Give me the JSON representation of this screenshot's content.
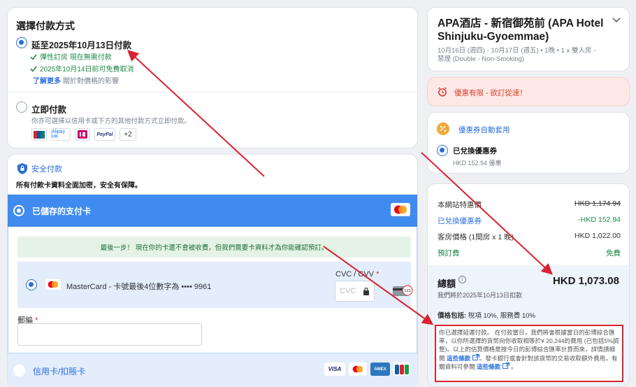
{
  "payment_method": {
    "title": "選擇付款方式",
    "pay_later": {
      "label": "延至2025年10月13日付款",
      "bullet_1": "彈性訂房 現在無需付款",
      "bullet_2": "2025年10月14日前可免費取消",
      "learn_more": "了解更多",
      "learn_more_sub": "關於對價格的影響"
    },
    "pay_now": {
      "label": "立即付款",
      "sub": "你亦可選擇以信用卡或下方的其他付款方式立即付款。",
      "logos": [
        "UnionPay",
        "Alipay HK",
        "iDEAL",
        "PayPal"
      ],
      "more": "+2"
    }
  },
  "secure": {
    "title": "安全付款",
    "subtitle": "所有付款卡資料全面加密，安全有保障。",
    "saved_card_label": "已儲存的支付卡",
    "notice": "最後一步！ 現在你的卡還不會被收費，但我們需要卡資料才為你能確認預訂。",
    "card_number": "MasterCard - 卡號最後4位數字為 •••• 9961",
    "cvc_label": "CVC / CVV",
    "required_mark": "*",
    "cvc_placeholder": "CVC",
    "cvc_card_text": "123",
    "postal_label": "郵編",
    "credit_card_label": "信用卡/扣賬卡",
    "brands": [
      "VISA",
      "MC",
      "AMEX",
      "JCB"
    ]
  },
  "hotel": {
    "name": "APA酒店 - 新宿御苑前 (APA Hotel Shinjuku-Gyoemmae)",
    "details": "10月16日 (週四) - 10月17日 (週五) • 1晚 • 1 x 雙人房 - 禁煙 (Double - Non-Smoking)"
  },
  "urgency": {
    "text": "優惠有限 - 欲訂從速！"
  },
  "coupon": {
    "heading": "優惠券自動套用",
    "label": "已兌換優惠券",
    "value": "HKD 152.94 優惠"
  },
  "price": {
    "rows": [
      {
        "label": "本網站特惠價",
        "value": "HKD 1,174.94"
      },
      {
        "label": "已兌換優惠券",
        "value": "-HKD 152.94"
      },
      {
        "label": "客房價格 (1間房 x 1 晚)",
        "value": "HKD 1,022.00"
      },
      {
        "label": "預訂費",
        "value": "免費"
      }
    ],
    "total_label": "總額",
    "total_info": "i",
    "total_value": "HKD 1,073.08",
    "total_sub": "我們將於2025年10月13日扣款",
    "includes_label": "價格包括:",
    "includes_value": "稅項 10%, 服務費 10%",
    "fx_note_1": "你已選擇延遲付款。 在付款當日，我們將會根據當日的彭博綜合匯率，以你所選擇的貨幣向你收取相等於¥ 20,244的費用 (已包括5%調整)。以上的估算價格是按今日的彭博綜合匯率計算而來，詳情請細閱",
    "fx_link_1": "這些條款",
    "fx_note_2": "。發卡銀行或會針對該貨幣的交易收取額外費用，有關資料可參閱",
    "fx_link_2": "這些條款",
    "fx_note_3": "。"
  },
  "colors": {
    "accent": "#2a6fdb",
    "success": "#1f8a4c",
    "alert": "#d9232e",
    "saved_bar": "#3f8bf0"
  }
}
